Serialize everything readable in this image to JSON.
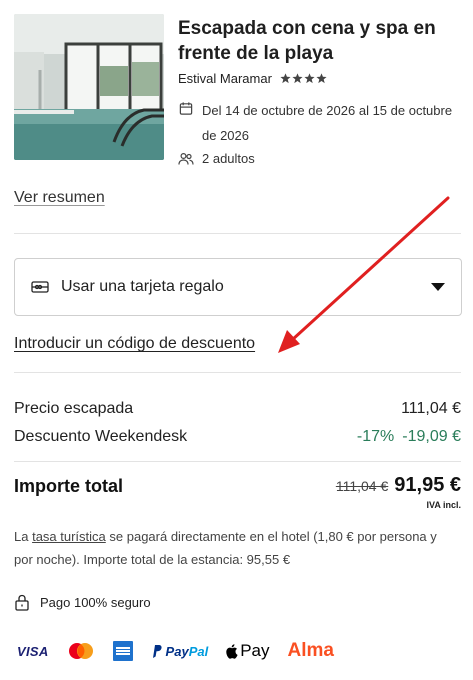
{
  "offer": {
    "title": "Escapada con cena y spa en frente de la playa",
    "hotel": "Estival Maramar",
    "stars": 4,
    "dates": "Del 14 de octubre de 2026 al 15 de octubre de 2026",
    "guests": "2 adultos"
  },
  "summary_link": "Ver resumen",
  "gift_card": {
    "label": "Usar una tarjeta regalo"
  },
  "discount_link": "Introducir un código de descuento",
  "pricing": {
    "base_label": "Precio escapada",
    "base_value": "111,04 €",
    "discount_label": "Descuento Weekendesk",
    "discount_percent": "-17%",
    "discount_value": "-19,09 €",
    "total_label": "Importe total",
    "total_old": "111,04 €",
    "total_new": "91,95 €",
    "vat_note": "IVA incl."
  },
  "tax_note": {
    "prefix": "La ",
    "link": "tasa turística",
    "suffix": " se pagará directamente en el hotel (1,80 € por persona y por noche). Importe total de la estancia: 95,55 €"
  },
  "secure_payment": "Pago 100% seguro",
  "payment_methods": {
    "visa": "VISA",
    "paypal_1": "Pay",
    "paypal_2": "Pal",
    "applepay": "Pay",
    "alma": "Alma"
  },
  "colors": {
    "discount_green": "#2a7d5a",
    "annotation_arrow": "#e02020",
    "alma_orange": "#fa5022"
  }
}
